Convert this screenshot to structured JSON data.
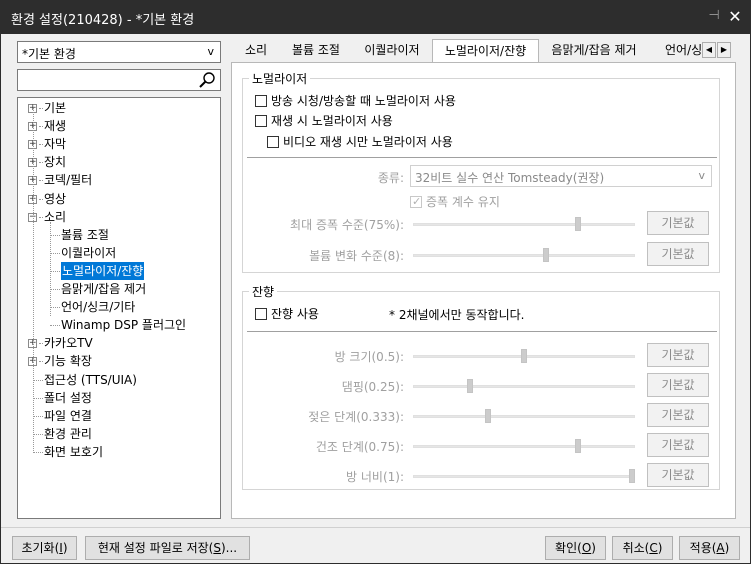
{
  "window": {
    "title": "환경 설정(210428) - *기본 환경",
    "pin_glyph": "⊣",
    "close_glyph": "✕"
  },
  "left": {
    "preset_value": "*기본 환경",
    "search_placeholder": "",
    "tree": [
      {
        "label": "기본",
        "expandable": true,
        "level": 0
      },
      {
        "label": "재생",
        "expandable": true,
        "level": 0
      },
      {
        "label": "자막",
        "expandable": true,
        "level": 0
      },
      {
        "label": "장치",
        "expandable": true,
        "level": 0
      },
      {
        "label": "코덱/필터",
        "expandable": true,
        "level": 0
      },
      {
        "label": "영상",
        "expandable": true,
        "level": 0
      },
      {
        "label": "소리",
        "expandable": true,
        "expanded": true,
        "level": 0
      },
      {
        "label": "볼륨 조절",
        "level": 1
      },
      {
        "label": "이퀄라이저",
        "level": 1
      },
      {
        "label": "노멀라이저/잔향",
        "level": 1,
        "selected": true
      },
      {
        "label": "음맑게/잡음 제거",
        "level": 1
      },
      {
        "label": "언어/싱크/기타",
        "level": 1
      },
      {
        "label": "Winamp DSP 플러그인",
        "level": 1
      },
      {
        "label": "카카오TV",
        "expandable": true,
        "level": 0
      },
      {
        "label": "기능 확장",
        "expandable": true,
        "level": 0
      },
      {
        "label": "접근성 (TTS/UIA)",
        "level": 0
      },
      {
        "label": "폴더 설정",
        "level": 0
      },
      {
        "label": "파일 연결",
        "level": 0
      },
      {
        "label": "환경 관리",
        "level": 0
      },
      {
        "label": "화면 보호기",
        "level": 0
      }
    ]
  },
  "tabs": [
    {
      "label": "소리"
    },
    {
      "label": "볼륨 조절"
    },
    {
      "label": "이퀄라이저"
    },
    {
      "label": "노멀라이저/잔향",
      "active": true
    },
    {
      "label": "음맑게/잡음 제거"
    },
    {
      "label": "언어/싱"
    }
  ],
  "normalizer": {
    "group_title": "노멀라이저",
    "cb_broadcast": "방송 시청/방송할 때 노멀라이저 사용",
    "cb_playback": "재생 시 노멀라이저 사용",
    "cb_video_only": "비디오 재생 시만 노멀라이저 사용",
    "type_label": "종류:",
    "type_value": "32비트 실수 연산 Tomsteady(권장)",
    "cb_keep_gain": "증폭 계수 유지",
    "max_gain_label": "최대 증폭 수준(75%):",
    "max_gain_value": 0.75,
    "vol_change_label": "볼륨 변화 수준(8):",
    "vol_change_value": 0.6,
    "default_btn": "기본값"
  },
  "reverb": {
    "group_title": "잔향",
    "cb_use": "잔향 사용",
    "note": "* 2채널에서만 동작합니다.",
    "sliders": [
      {
        "label": "방 크기(0.5):",
        "value": 0.5
      },
      {
        "label": "댐핑(0.25):",
        "value": 0.25
      },
      {
        "label": "젖은 단계(0.333):",
        "value": 0.333
      },
      {
        "label": "건조 단계(0.75):",
        "value": 0.75
      },
      {
        "label": "방 너비(1):",
        "value": 1.0
      }
    ],
    "default_btn": "기본값"
  },
  "footer": {
    "reset_prefix": "초기화(",
    "reset_key": "I",
    "reset_suffix": ")",
    "save_prefix": "현재 설정 파일로 저장(",
    "save_key": "S",
    "save_suffix": ")...",
    "ok_prefix": "확인(",
    "ok_key": "O",
    "ok_suffix": ")",
    "cancel_prefix": "취소(",
    "cancel_key": "C",
    "cancel_suffix": ")",
    "apply_prefix": "적용(",
    "apply_key": "A",
    "apply_suffix": ")"
  }
}
